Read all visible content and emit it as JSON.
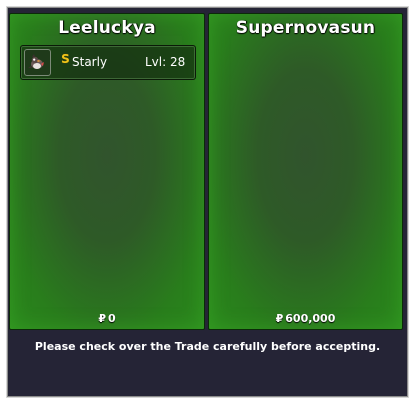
{
  "trade": {
    "left": {
      "player": "Leeluckya",
      "items": [
        {
          "icon": "starly-sprite-icon",
          "badge_icon": "shiny-s-icon",
          "badge_text": "S",
          "name": "Starly",
          "level": "Lvl: 28"
        }
      ],
      "money": "0"
    },
    "right": {
      "player": "Supernovasun",
      "items": [],
      "money": "600,000"
    },
    "money_glyph": "₽",
    "notice": "Please check over the Trade carefully before accepting."
  },
  "colors": {
    "panel_green": "#2a8a1c",
    "window_bg": "#252436",
    "shiny_badge": "#f0c419"
  }
}
